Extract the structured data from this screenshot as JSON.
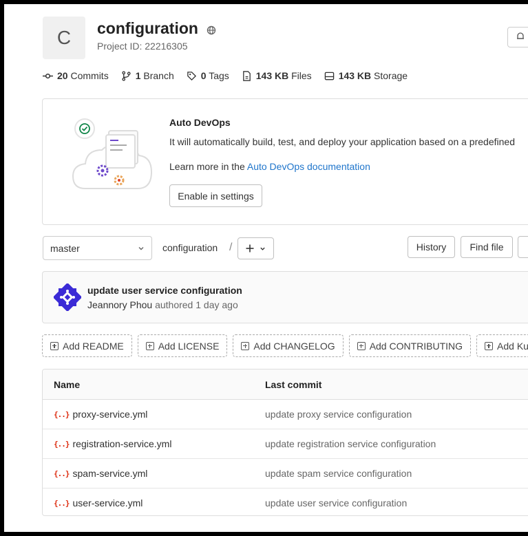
{
  "project": {
    "avatar_letter": "C",
    "title": "configuration",
    "project_id": "Project ID: 22216305"
  },
  "stats": [
    {
      "icon": "commit-icon",
      "count": "20",
      "label": "Commits"
    },
    {
      "icon": "branch-icon",
      "count": "1",
      "label": "Branch"
    },
    {
      "icon": "tag-icon",
      "count": "0",
      "label": "Tags"
    },
    {
      "icon": "file-icon",
      "count": "143 KB",
      "label": "Files"
    },
    {
      "icon": "storage-icon",
      "count": "143 KB",
      "label": "Storage"
    }
  ],
  "devops": {
    "title": "Auto DevOps",
    "description": "It will automatically build, test, and deploy your application based on a predefined",
    "learn_prefix": "Learn more in the ",
    "learn_link": "Auto DevOps documentation",
    "enable_button": "Enable in settings"
  },
  "repo_nav": {
    "branch": "master",
    "breadcrumb": "configuration",
    "separator": "/",
    "history_button": "History",
    "find_file_button": "Find file"
  },
  "last_commit": {
    "title": "update user service configuration",
    "author": "Jeannory Phou",
    "meta": " authored 1 day ago"
  },
  "add_buttons": [
    {
      "label": "Add README"
    },
    {
      "label": "Add LICENSE"
    },
    {
      "label": "Add CHANGELOG"
    },
    {
      "label": "Add CONTRIBUTING"
    },
    {
      "label": "Add Kubernetes cluster"
    }
  ],
  "file_table": {
    "headers": {
      "name": "Name",
      "last_commit": "Last commit"
    },
    "rows": [
      {
        "name": "proxy-service.yml",
        "commit": "update proxy service configuration"
      },
      {
        "name": "registration-service.yml",
        "commit": "update registration service configuration"
      },
      {
        "name": "spam-service.yml",
        "commit": "update spam service configuration"
      },
      {
        "name": "user-service.yml",
        "commit": "update user service configuration"
      }
    ]
  },
  "colors": {
    "link": "#1f75cb",
    "yml_icon": "#dd2b0e",
    "devops_accent": "#6e49cb"
  }
}
